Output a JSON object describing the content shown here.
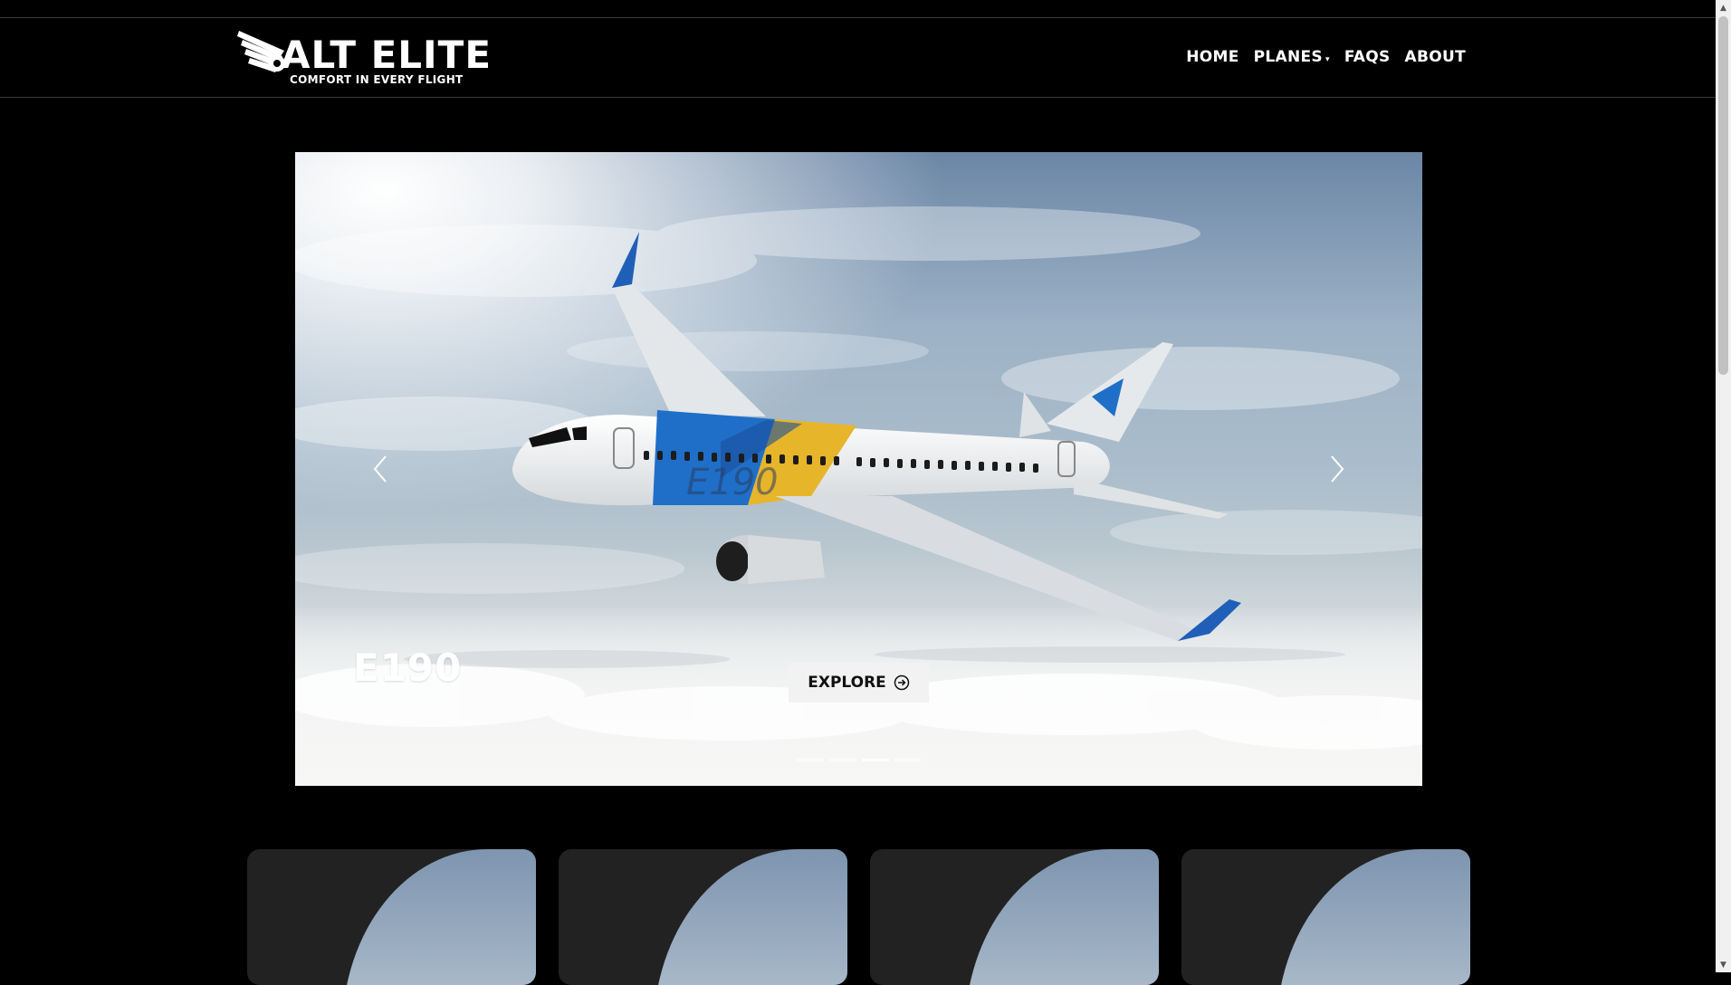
{
  "brand": {
    "name": "ALT ELITE",
    "tagline": "COMFORT IN EVERY FLIGHT"
  },
  "nav": {
    "items": [
      {
        "label": "HOME",
        "has_dropdown": false
      },
      {
        "label": "PLANES",
        "has_dropdown": true
      },
      {
        "label": "FAQS",
        "has_dropdown": false
      },
      {
        "label": "ABOUT",
        "has_dropdown": false
      }
    ]
  },
  "hero": {
    "title": "E190",
    "button_label": "EXPLORE",
    "fuselage_text": "E190",
    "slide_count": 4,
    "active_slide": 3
  },
  "cards": [
    {
      "name": "card-1"
    },
    {
      "name": "card-2"
    },
    {
      "name": "card-3"
    },
    {
      "name": "card-4"
    }
  ],
  "colors": {
    "background": "#000000",
    "text": "#ffffff",
    "button_bg": "#f2f2f2",
    "card_bg": "#222222",
    "livery_blue": "#1f6fc8",
    "livery_yellow": "#e7b52a"
  }
}
